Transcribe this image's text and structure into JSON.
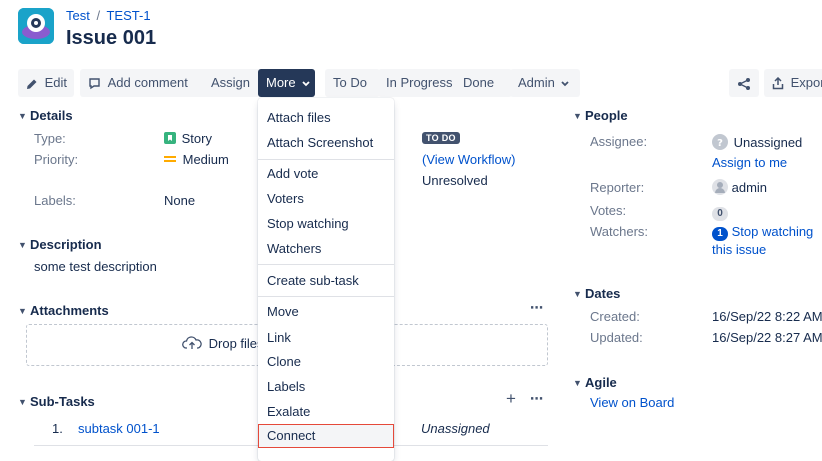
{
  "header": {
    "project": "Test",
    "separator": "/",
    "issue_key": "TEST-1",
    "title": "Issue 001"
  },
  "toolbar": {
    "edit": "Edit",
    "add_comment": "Add comment",
    "assign": "Assign",
    "more": "More",
    "todo": "To Do",
    "in_progress": "In Progress",
    "done": "Done",
    "admin": "Admin",
    "export": "Export"
  },
  "details": {
    "title": "Details",
    "type_label": "Type:",
    "type_value": "Story",
    "priority_label": "Priority:",
    "priority_value": "Medium",
    "labels_label": "Labels:",
    "labels_value": "None",
    "status_value": "TO DO",
    "workflow_link": "(View Workflow)",
    "resolution_value": "Unresolved"
  },
  "description": {
    "title": "Description",
    "text": "some test description"
  },
  "attachments": {
    "title": "Attachments",
    "drop_text": "Drop files"
  },
  "subtasks": {
    "title": "Sub-Tasks",
    "items": [
      {
        "num": "1.",
        "name": "subtask 001-1",
        "assignee": "Unassigned"
      }
    ]
  },
  "more_menu": {
    "items": [
      "Attach files",
      "Attach Screenshot",
      "Add vote",
      "Voters",
      "Stop watching",
      "Watchers",
      "Create sub-task",
      "Move",
      "Link",
      "Clone",
      "Labels",
      "Exalate",
      "Connect"
    ]
  },
  "people": {
    "title": "People",
    "assignee_label": "Assignee:",
    "assignee_value": "Unassigned",
    "assign_to_me": "Assign to me",
    "reporter_label": "Reporter:",
    "reporter_value": "admin",
    "votes_label": "Votes:",
    "votes_count": "0",
    "watchers_label": "Watchers:",
    "watchers_count": "1",
    "stop_watching": "Stop watching",
    "this_issue": "this issue"
  },
  "dates": {
    "title": "Dates",
    "created_label": "Created:",
    "created_value": "16/Sep/22 8:22 AM",
    "updated_label": "Updated:",
    "updated_value": "16/Sep/22 8:27 AM"
  },
  "agile": {
    "title": "Agile",
    "view_on_board": "View on Board"
  },
  "colors": {
    "link": "#0052cc",
    "more_active_bg": "#253858",
    "highlight_border": "#e5493a",
    "story_green": "#36b37e",
    "priority_orange": "#ffab00"
  }
}
